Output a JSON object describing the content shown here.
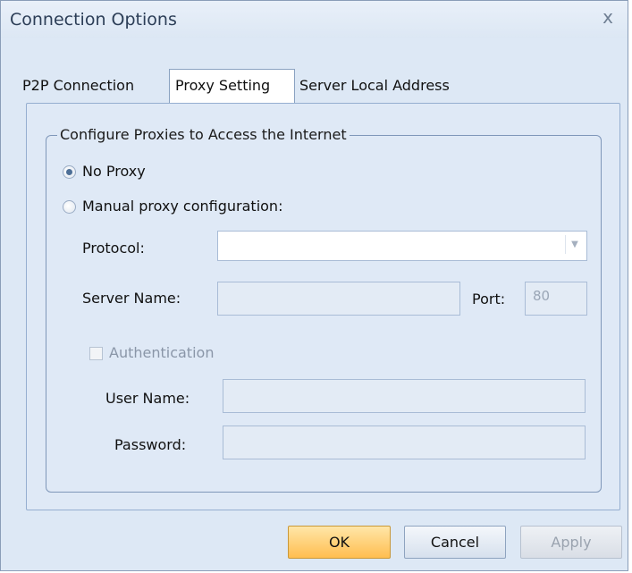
{
  "window": {
    "title": "Connection Options",
    "close_glyph": "x"
  },
  "tabs": [
    {
      "label": "P2P Connection",
      "active": false
    },
    {
      "label": "Proxy Setting",
      "active": true
    },
    {
      "label": "Server Local Address",
      "active": false
    }
  ],
  "proxy": {
    "group_title": "Configure Proxies to Access the Internet",
    "no_proxy_label": "No Proxy",
    "manual_label": "Manual proxy configuration:",
    "selected": "No Proxy",
    "protocol_label": "Protocol:",
    "protocol_value": "",
    "server_label": "Server Name:",
    "server_value": "",
    "port_label": "Port:",
    "port_value": "80",
    "auth_label": "Authentication",
    "auth_checked": false,
    "username_label": "User Name:",
    "username_value": "",
    "password_label": "Password:",
    "password_value": ""
  },
  "buttons": {
    "ok": "OK",
    "cancel": "Cancel",
    "apply": "Apply"
  },
  "colors": {
    "ok_button": "#ffbe50",
    "window_bg": "#dde8f5"
  }
}
